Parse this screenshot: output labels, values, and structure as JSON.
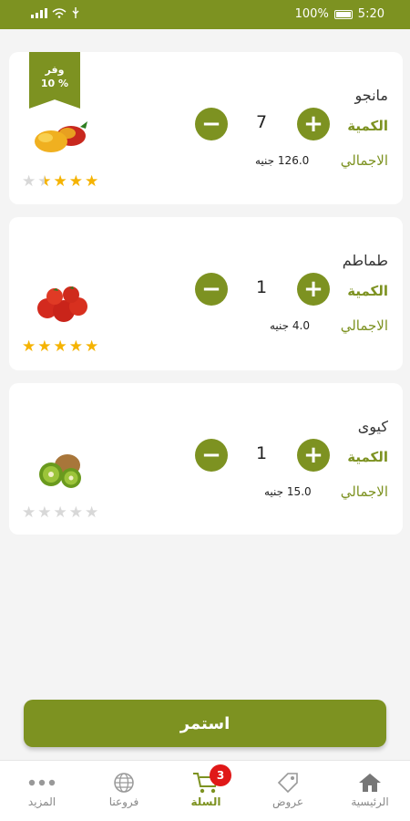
{
  "status": {
    "battery": "100%",
    "time": "5:20"
  },
  "currency": "جنيه",
  "labels": {
    "quantity": "الكمية",
    "total": "الاجمالي"
  },
  "products": [
    {
      "name": "مانجو",
      "qty": "7",
      "total": "126.0",
      "rating": 4.5,
      "image": "mango-icon",
      "discount": {
        "line1": "وفر",
        "line2": "10 %"
      }
    },
    {
      "name": "طماطم",
      "qty": "1",
      "total": "4.0",
      "rating": 5,
      "image": "tomato-icon"
    },
    {
      "name": "كيوى",
      "qty": "1",
      "total": "15.0",
      "rating": 0,
      "image": "kiwi-icon"
    }
  ],
  "continue_label": "استمر",
  "nav": {
    "home": "الرئيسية",
    "offers": "عروض",
    "cart": "السلة",
    "cart_badge": "3",
    "branches": "فروعنا",
    "more": "المزيد"
  },
  "colors": {
    "primary": "#7d9221",
    "star": "#f5b301",
    "badge": "#e01818"
  }
}
